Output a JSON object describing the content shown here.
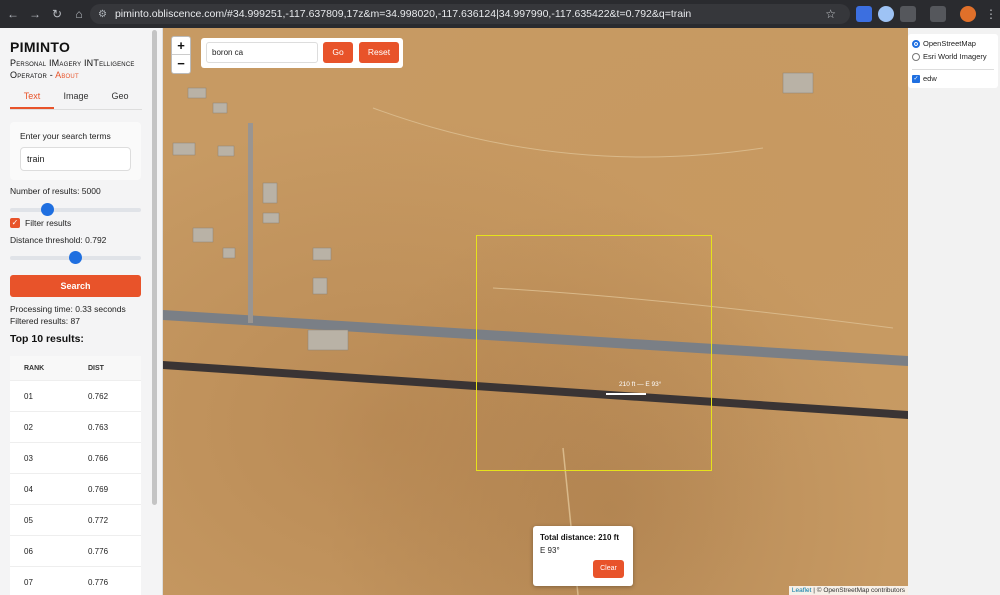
{
  "browser": {
    "url": "piminto.obliscence.com/#34.999251,-117.637809,17z&m=34.998020,-117.636124|34.997990,-117.635422&t=0.792&q=train"
  },
  "sidebar": {
    "brand": "PIMINTO",
    "subtitle_prefix": "Personal IMagery INTelligence Operator - ",
    "about_link": "About",
    "tabs": [
      "Text",
      "Image",
      "Geo"
    ],
    "search_label": "Enter your search terms",
    "search_value": "train",
    "num_results_label": "Number of results: 5000",
    "num_results_fraction": 0.26,
    "filter_label": "Filter results",
    "distance_label": "Distance threshold: 0.792",
    "distance_fraction": 0.5,
    "search_button": "Search",
    "processing_time": "Processing time: 0.33 seconds",
    "filtered_results": "Filtered results: 87",
    "top_title": "Top 10 results:",
    "table_headers": [
      "RANK",
      "DIST"
    ],
    "rows": [
      [
        "01",
        "0.762"
      ],
      [
        "02",
        "0.763"
      ],
      [
        "03",
        "0.766"
      ],
      [
        "04",
        "0.769"
      ],
      [
        "05",
        "0.772"
      ],
      [
        "06",
        "0.776"
      ],
      [
        "07",
        "0.776"
      ]
    ]
  },
  "map": {
    "zoom_in": "+",
    "zoom_out": "−",
    "geo_search_value": "boron ca",
    "go_button": "Go",
    "reset_button": "Reset",
    "layers": {
      "base": [
        "OpenStreetMap",
        "Esri World Imagery"
      ],
      "overlay": "edw"
    },
    "measure_label": "210 ft — E 93°",
    "distance_popup": {
      "title": "Total distance: 210 ft",
      "bearing": "E 93°",
      "clear": "Clear"
    },
    "attribution_leaflet": "Leaflet",
    "attribution_rest": "| © OpenStreetMap contributors"
  }
}
